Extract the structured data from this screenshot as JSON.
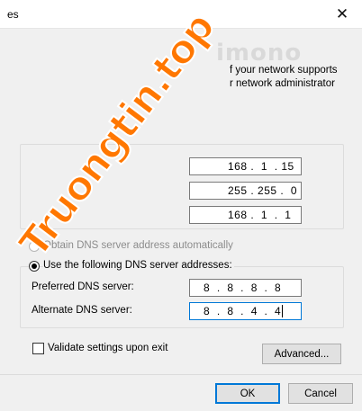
{
  "window": {
    "title_fragment": "es",
    "close_glyph": "✕"
  },
  "intro": {
    "line1": "f your network supports",
    "line2": "r network administrator"
  },
  "ip_fields": {
    "ip_address": "168 .  1  . 15",
    "subnet_mask": "255 . 255 .  0",
    "default_gateway": "168 .  1  .  1"
  },
  "dns": {
    "auto_label": "Obtain DNS server address automatically",
    "auto_selected": false,
    "manual_label": "Use the following DNS server addresses:",
    "manual_selected": true,
    "preferred_label": "Preferred DNS server:",
    "preferred_value": "8  .  8  .  8  .  8",
    "alternate_label": "Alternate DNS server:",
    "alternate_value": "8  .  8  .  4  .  4"
  },
  "validate": {
    "label": "Validate settings upon exit",
    "checked": false
  },
  "buttons": {
    "advanced": "Advanced...",
    "ok": "OK",
    "cancel": "Cancel"
  },
  "watermark": {
    "text": "Truongtin.top",
    "faint": "imono"
  },
  "colors": {
    "accent": "#0078d7",
    "watermark": "#ff7700"
  }
}
